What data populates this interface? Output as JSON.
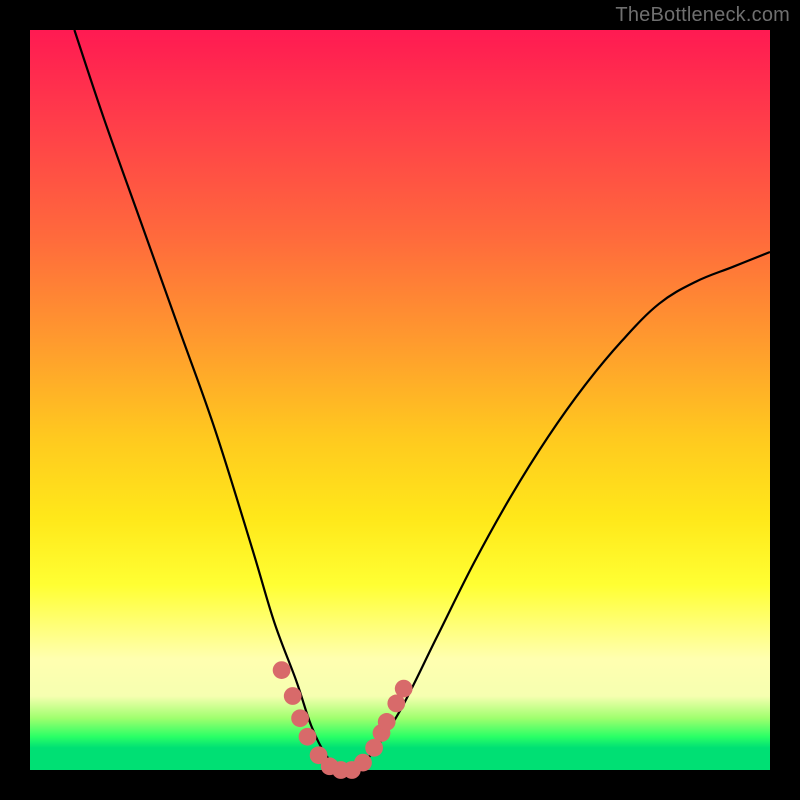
{
  "watermark": "TheBottleneck.com",
  "colors": {
    "frame": "#000000",
    "gradient_top": "#ff1a52",
    "gradient_mid": "#ffe81a",
    "gradient_bottom": "#00e074",
    "curve_stroke": "#000000",
    "marker_fill": "#d86a6a"
  },
  "chart_data": {
    "type": "line",
    "title": "",
    "xlabel": "",
    "ylabel": "",
    "xlim": [
      0,
      100
    ],
    "ylim": [
      0,
      100
    ],
    "legend": false,
    "grid": false,
    "annotations": [
      "TheBottleneck.com"
    ],
    "series": [
      {
        "name": "bottleneck-curve",
        "x": [
          6,
          10,
          15,
          20,
          25,
          30,
          33,
          36,
          38,
          40,
          42,
          44,
          46,
          50,
          55,
          60,
          65,
          70,
          75,
          80,
          85,
          90,
          95,
          100
        ],
        "values": [
          100,
          88,
          74,
          60,
          46,
          30,
          20,
          12,
          6,
          2,
          0,
          0,
          2,
          8,
          18,
          28,
          37,
          45,
          52,
          58,
          63,
          66,
          68,
          70
        ]
      }
    ],
    "markers": [
      {
        "x": 34.0,
        "y": 13.5
      },
      {
        "x": 35.5,
        "y": 10.0
      },
      {
        "x": 36.5,
        "y": 7.0
      },
      {
        "x": 37.5,
        "y": 4.5
      },
      {
        "x": 39.0,
        "y": 2.0
      },
      {
        "x": 40.5,
        "y": 0.5
      },
      {
        "x": 42.0,
        "y": 0.0
      },
      {
        "x": 43.5,
        "y": 0.0
      },
      {
        "x": 45.0,
        "y": 1.0
      },
      {
        "x": 46.5,
        "y": 3.0
      },
      {
        "x": 47.5,
        "y": 5.0
      },
      {
        "x": 48.2,
        "y": 6.5
      },
      {
        "x": 49.5,
        "y": 9.0
      },
      {
        "x": 50.5,
        "y": 11.0
      }
    ],
    "marker_radius_fraction": 0.012
  }
}
